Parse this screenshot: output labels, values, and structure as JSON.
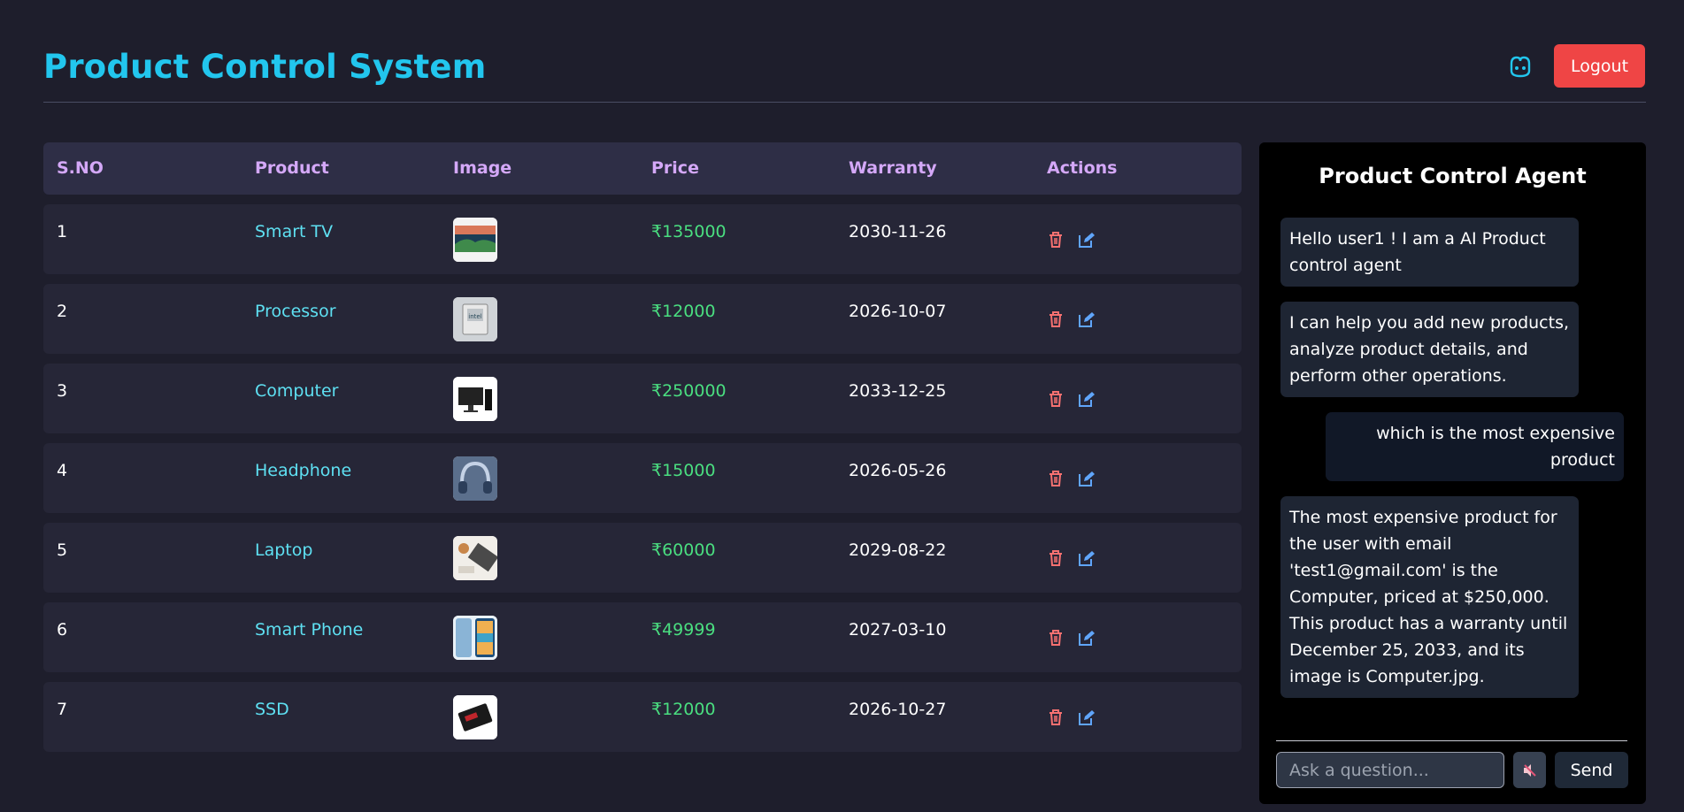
{
  "header": {
    "title": "Product Control System",
    "logout_label": "Logout"
  },
  "table": {
    "columns": [
      "S.NO",
      "Product",
      "Image",
      "Price",
      "Warranty",
      "Actions"
    ],
    "rows": [
      {
        "sno": "1",
        "product": "Smart TV",
        "price": "₹135000",
        "warranty": "2030-11-26",
        "image": "smart-tv-image"
      },
      {
        "sno": "2",
        "product": "Processor",
        "price": "₹12000",
        "warranty": "2026-10-07",
        "image": "processor-image"
      },
      {
        "sno": "3",
        "product": "Computer",
        "price": "₹250000",
        "warranty": "2033-12-25",
        "image": "computer-image"
      },
      {
        "sno": "4",
        "product": "Headphone",
        "price": "₹15000",
        "warranty": "2026-05-26",
        "image": "headphone-image"
      },
      {
        "sno": "5",
        "product": "Laptop",
        "price": "₹60000",
        "warranty": "2029-08-22",
        "image": "laptop-image"
      },
      {
        "sno": "6",
        "product": "Smart Phone",
        "price": "₹49999",
        "warranty": "2027-03-10",
        "image": "smart-phone-image"
      },
      {
        "sno": "7",
        "product": "SSD",
        "price": "₹12000",
        "warranty": "2026-10-27",
        "image": "ssd-image"
      }
    ]
  },
  "chat": {
    "title": "Product Control Agent",
    "messages": [
      {
        "role": "bot",
        "text": "Hello user1 ! I am a AI Product control agent"
      },
      {
        "role": "bot",
        "text": "I can help you add new products, analyze product details, and perform other operations."
      },
      {
        "role": "user",
        "text": "which is the most expensive product"
      },
      {
        "role": "bot",
        "text": "The most expensive product for the user with email 'test1@gmail.com' is the Computer, priced at $250,000. This product has a warranty until December 25, 2033, and its image is Computer.jpg."
      }
    ],
    "input_placeholder": "Ask a question...",
    "input_value": "",
    "send_label": "Send"
  },
  "colors": {
    "background": "#1e1e2c",
    "title": "#22c6ee",
    "logout": "#ef4545",
    "header_text": "#d4a8f8",
    "product_link": "#5ee0f2",
    "price": "#4ade80",
    "delete_icon": "#f87171",
    "edit_icon": "#60a5fa"
  }
}
